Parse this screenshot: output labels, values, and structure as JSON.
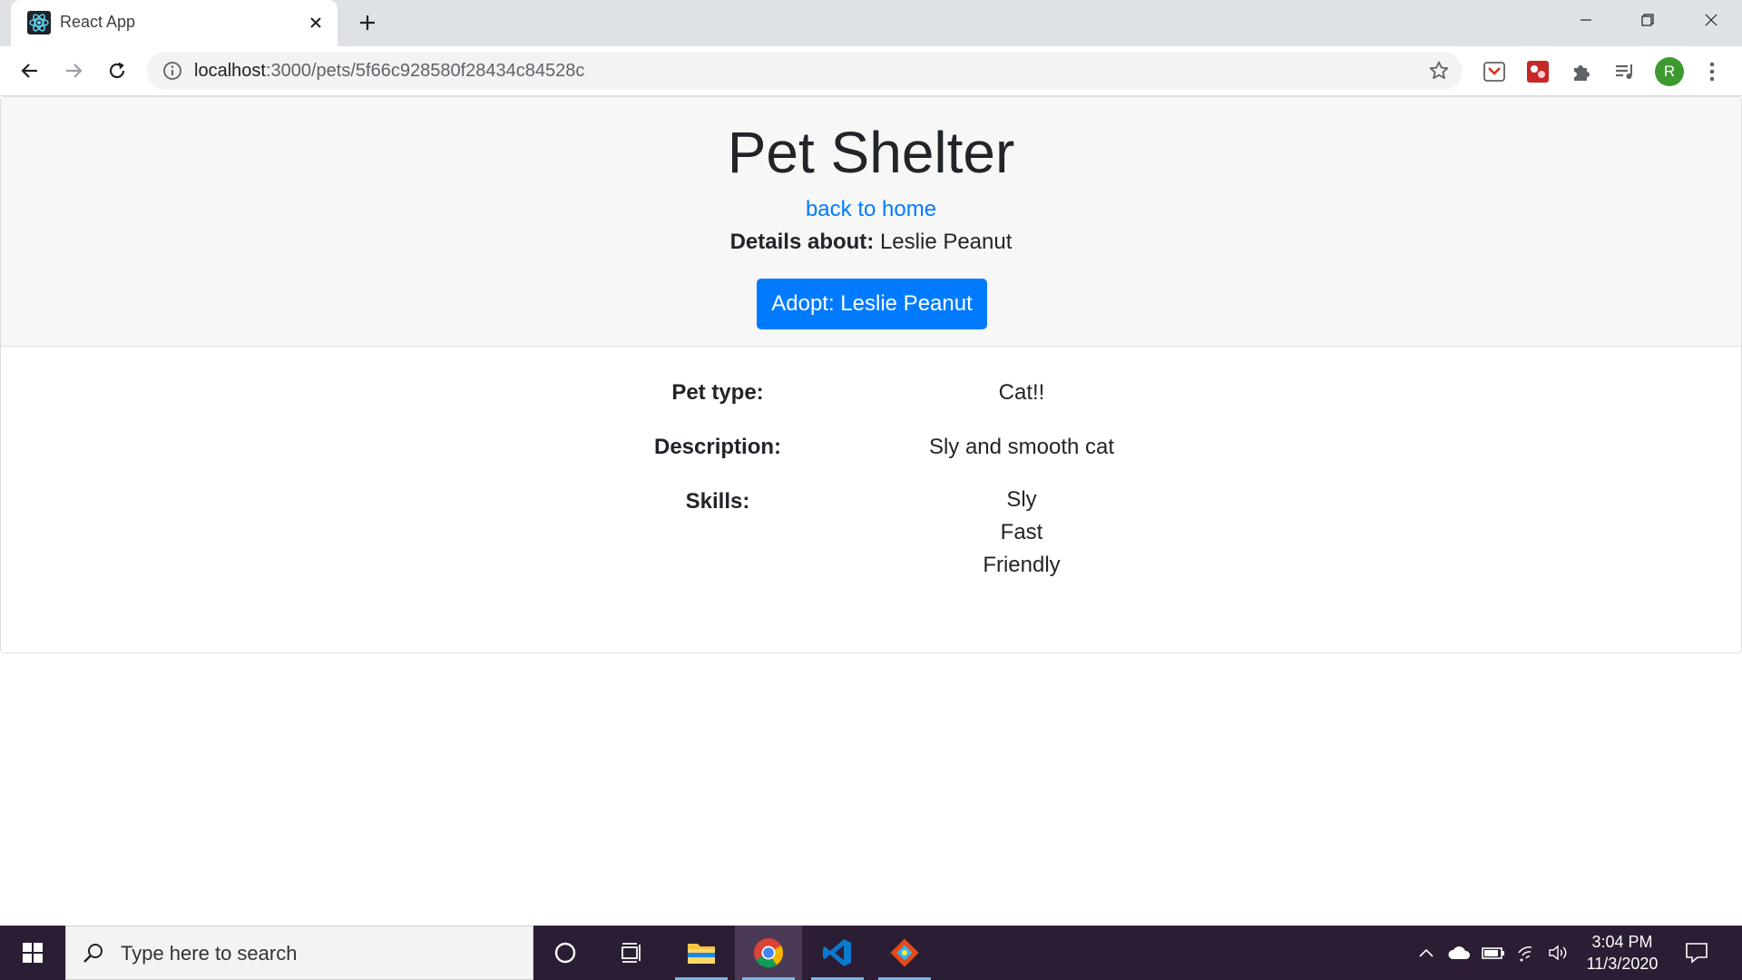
{
  "browser": {
    "tab_title": "React App",
    "url_host": "localhost",
    "url_path": ":3000/pets/5f66c928580f28434c84528c",
    "profile_initial": "R"
  },
  "page": {
    "title": "Pet Shelter",
    "back_link": "back to home",
    "details_label": "Details about:",
    "pet_name": "Leslie Peanut",
    "adopt_button": "Adopt: Leslie Peanut",
    "fields": {
      "type_label": "Pet type:",
      "type_value": "Cat!!",
      "description_label": "Description:",
      "description_value": "Sly and smooth cat",
      "skills_label": "Skills:",
      "skills": [
        "Sly",
        "Fast",
        "Friendly"
      ]
    }
  },
  "taskbar": {
    "search_placeholder": "Type here to search",
    "time": "3:04 PM",
    "date": "11/3/2020"
  },
  "colors": {
    "link": "#007bff",
    "button": "#007bff",
    "header_bg": "#f7f7f7",
    "taskbar_bg": "#2b1d34"
  },
  "icons": [
    "react-icon",
    "close-icon",
    "plus-icon",
    "minimize-icon",
    "restore-icon",
    "back-icon",
    "forward-icon",
    "reload-icon",
    "info-icon",
    "star-icon",
    "pocket-icon",
    "extension-icon",
    "puzzle-icon",
    "media-icon",
    "menu-icon",
    "windows-icon",
    "search-icon",
    "cortana-icon",
    "task-view-icon",
    "file-explorer-icon",
    "chrome-icon",
    "vscode-icon",
    "git-icon",
    "chevron-up-icon",
    "onedrive-icon",
    "battery-icon",
    "wifi-icon",
    "volume-icon",
    "notification-icon"
  ]
}
